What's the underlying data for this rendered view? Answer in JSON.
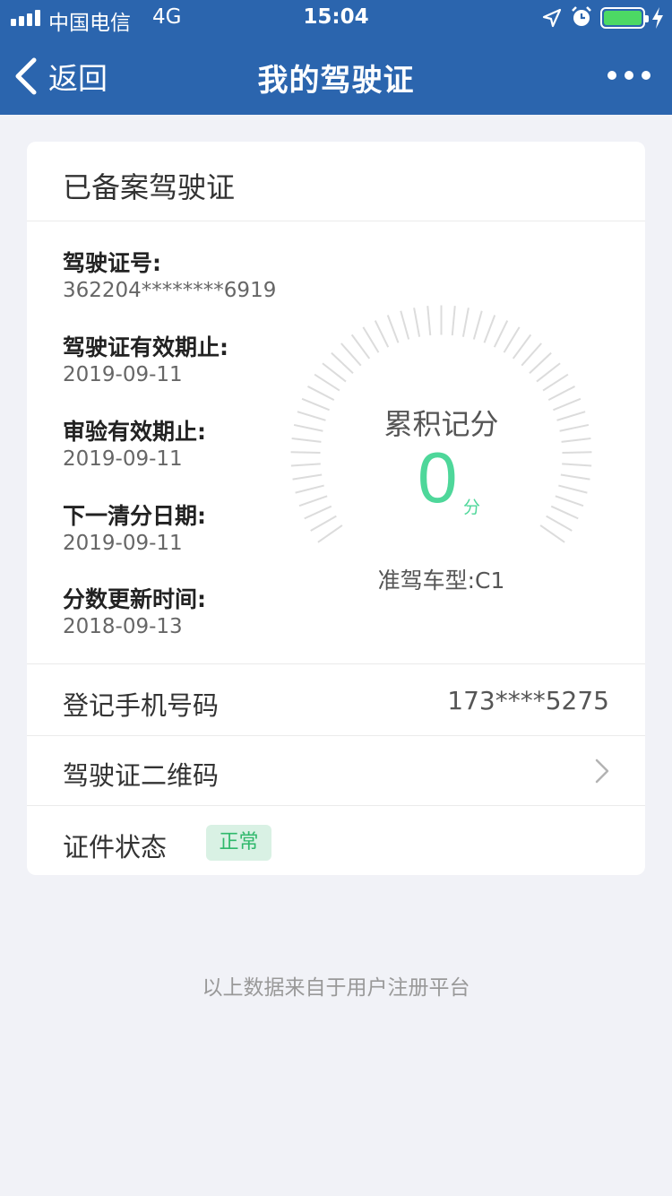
{
  "status_bar": {
    "carrier": "中国电信",
    "network": "4G",
    "time": "15:04",
    "battery_level": 1.0,
    "icons": [
      "signal-icon",
      "location-arrow-icon",
      "alarm-clock-icon",
      "battery-icon",
      "charging-bolt-icon"
    ]
  },
  "nav": {
    "back_label": "返回",
    "title": "我的驾驶证",
    "more_icon": "ellipsis-icon"
  },
  "card": {
    "title": "已备案驾驶证",
    "info": [
      {
        "label": "驾驶证号:",
        "value": "362204********6919"
      },
      {
        "label": "驾驶证有效期止:",
        "value": "2019-09-11"
      },
      {
        "label": "审验有效期止:",
        "value": "2019-09-11"
      },
      {
        "label": "下一清分日期:",
        "value": "2019-09-11"
      },
      {
        "label": "分数更新时间:",
        "value": "2018-09-13"
      }
    ],
    "gauge": {
      "title": "累积记分",
      "score": "0",
      "unit": "分",
      "car_type": "准驾车型:C1",
      "accent": "#4ed79a"
    },
    "phone": {
      "label": "登记手机号码",
      "value": "173****5275"
    },
    "qr": {
      "label": "驾驶证二维码",
      "icon": "chevron-right-icon"
    },
    "status": {
      "label": "证件状态",
      "badge": "正常",
      "badge_color": "#2fb86b"
    }
  },
  "footer": "以上数据来自于用户注册平台",
  "colors": {
    "nav_bg": "#2b65ae",
    "page_bg": "#f1f2f7"
  }
}
